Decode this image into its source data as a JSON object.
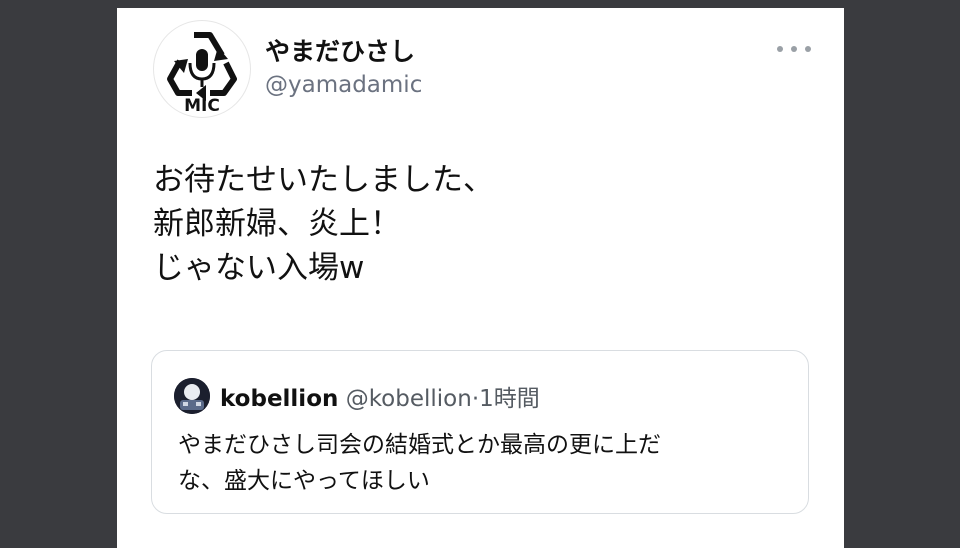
{
  "tweet": {
    "author": {
      "display_name": "やまだひさし",
      "handle": "@yamadamic",
      "avatar_text": "MIC"
    },
    "more_icon": "more-horizontal-icon",
    "text_lines": [
      "お待たせいたしました、",
      "新郎新婦、炎上！",
      "じゃない入場w"
    ],
    "quoted": {
      "display_name": "kobellion",
      "handle": "@kobellion",
      "separator": "·",
      "time": "1時間",
      "text_lines": [
        "やまだひさし司会の結婚式とか最高の更に上だ",
        "な、盛大にやってほしい"
      ]
    }
  },
  "colors": {
    "background": "#3a3b3f",
    "card": "#ffffff",
    "secondary_text": "#6b7280"
  }
}
